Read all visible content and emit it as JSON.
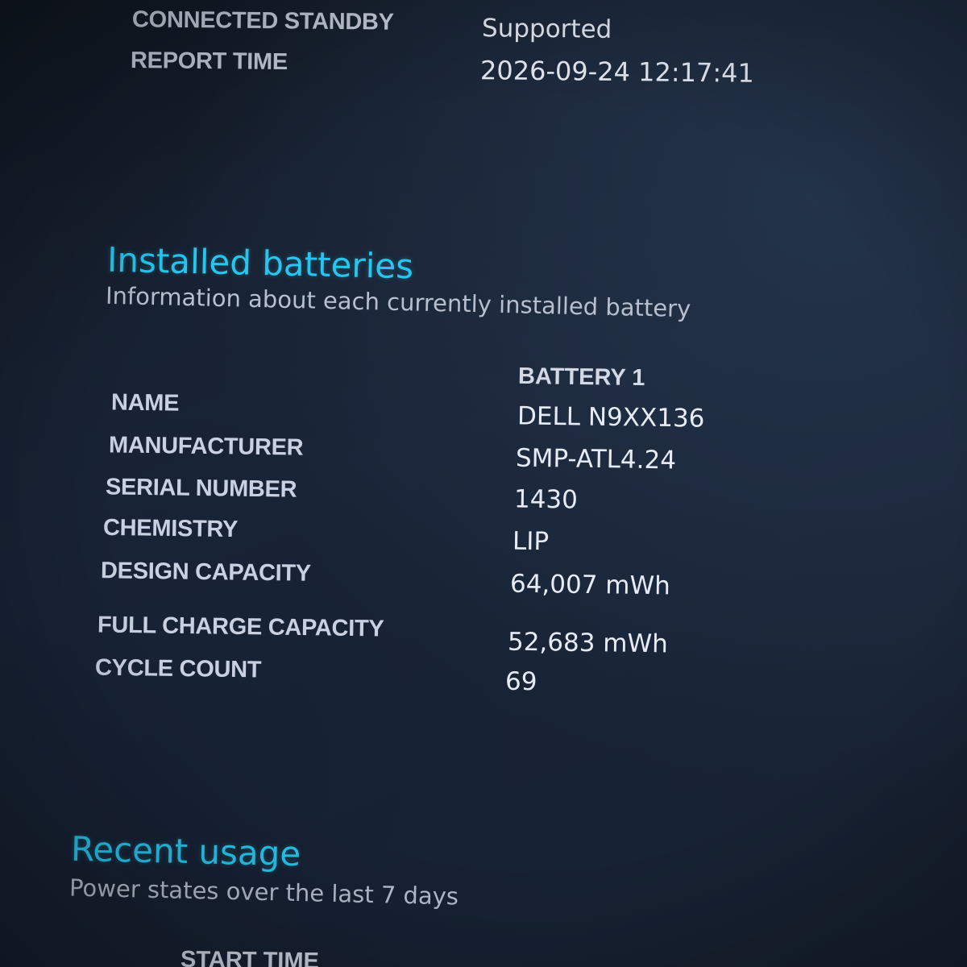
{
  "system_info": {
    "rows": [
      {
        "label": "CONNECTED STANDBY",
        "value": "Supported"
      },
      {
        "label": "REPORT TIME",
        "value": "2026-09-24  12:17:41"
      }
    ]
  },
  "installed_batteries": {
    "title": "Installed batteries",
    "subtitle": "Information about each currently installed battery",
    "column_header": "BATTERY 1",
    "rows": [
      {
        "label": "NAME",
        "value": "DELL N9XX136"
      },
      {
        "label": "MANUFACTURER",
        "value": "SMP-ATL4.24"
      },
      {
        "label": "SERIAL NUMBER",
        "value": "1430"
      },
      {
        "label": "CHEMISTRY",
        "value": "LIP"
      },
      {
        "label": "DESIGN CAPACITY",
        "value": "64,007 mWh"
      },
      {
        "label": "FULL CHARGE CAPACITY",
        "value": "52,683 mWh"
      },
      {
        "label": "CYCLE COUNT",
        "value": "69"
      }
    ]
  },
  "recent_usage": {
    "title": "Recent usage",
    "subtitle": "Power states over the last 7 days",
    "column_header": "START TIME"
  },
  "colors": {
    "heading": "#28c6ee",
    "background": "#151d2a",
    "label": "#c9d0e0",
    "value": "#e6ebf5"
  }
}
